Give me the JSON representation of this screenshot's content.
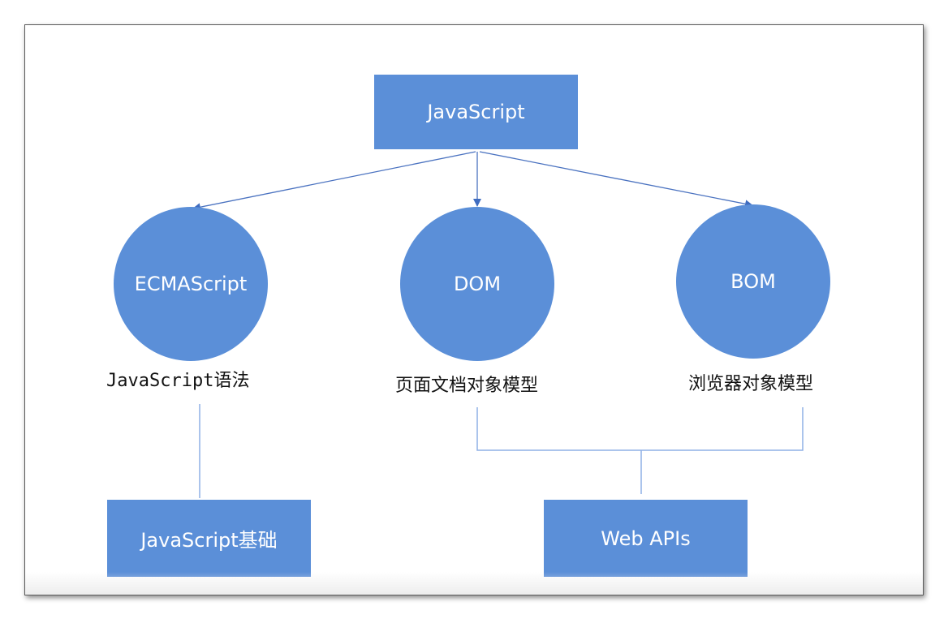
{
  "diagram": {
    "root": {
      "label": "JavaScript"
    },
    "branches": [
      {
        "label": "ECMAScript",
        "caption_mono": "JavaScript",
        "caption_cjk": "语法"
      },
      {
        "label": "DOM",
        "caption": "页面文档对象模型"
      },
      {
        "label": "BOM",
        "caption": "浏览器对象模型"
      }
    ],
    "leaves": [
      {
        "label": "JavaScript基础"
      },
      {
        "label": "Web APIs"
      }
    ]
  },
  "colors": {
    "node_fill": "#5b8fd8",
    "connector": "#4a72c0",
    "caption_text": "#111111"
  }
}
